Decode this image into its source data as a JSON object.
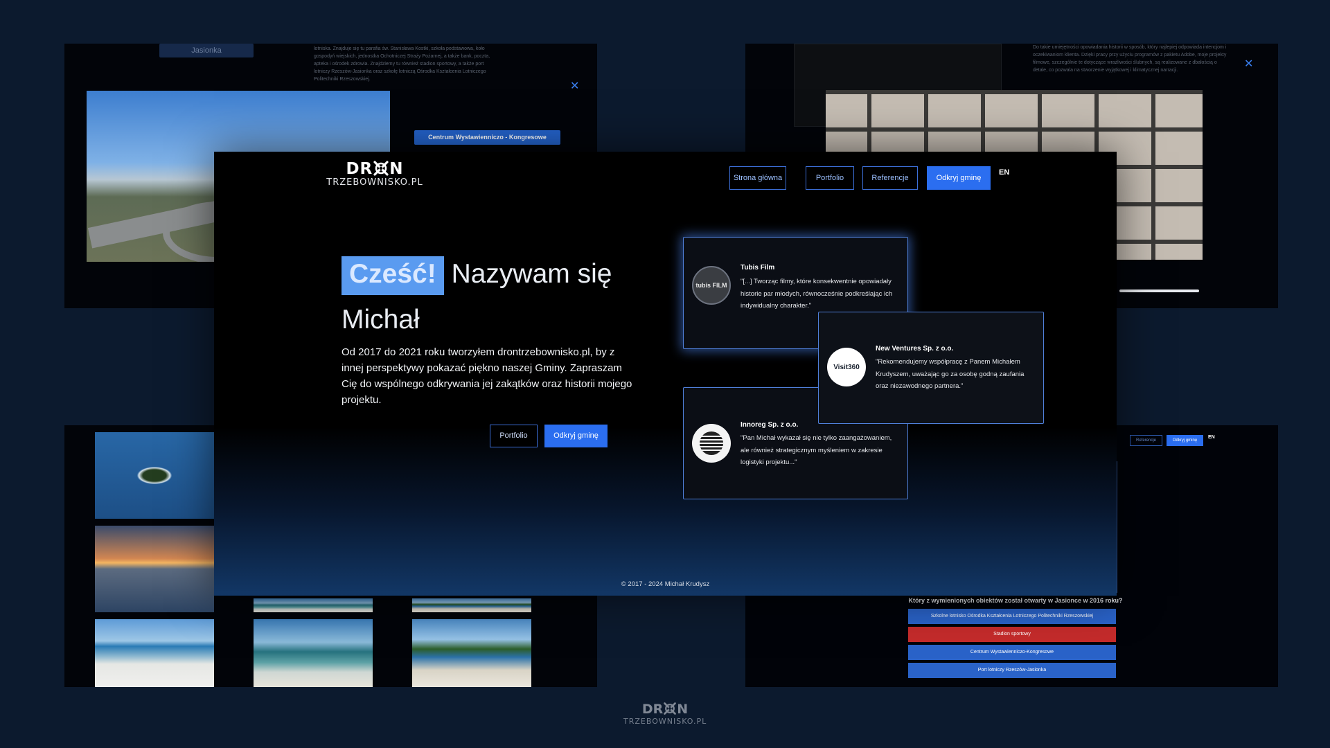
{
  "brand": {
    "logo_top": "DR N",
    "logo_bottom": "TRZEBOWNISKO.PL"
  },
  "nav": {
    "home": "Strona główna",
    "portfolio": "Portfolio",
    "references": "Referencje",
    "discover": "Odkryj gminę",
    "lang": "EN"
  },
  "hero": {
    "hi": "Cześć!",
    "rest": " Nazywam się Michał",
    "text": "Od 2017 do 2021 roku tworzyłem drontrzebownisko.pl, by z innej perspektywy pokazać piękno naszej Gminy. Zapraszam Cię do wspólnego odkrywania jej zakątków oraz historii mojego projektu.",
    "cta_portfolio": "Portfolio",
    "cta_discover": "Odkryj gminę"
  },
  "references": [
    {
      "name": "Tubis Film",
      "logo": "tubis FILM",
      "quote": "\"[...] Tworząc filmy, które konsekwentnie opowiadały historie par młodych, równocześnie podkreślając ich indywidualny charakter.\""
    },
    {
      "name": "New Ventures Sp. z o.o.",
      "logo": "Visit360",
      "quote": "\"Rekomendujemy współpracę z Panem Michałem Krudyszem, uważając go za osobę godną zaufania oraz niezawodnego partnera.\""
    },
    {
      "name": "Innoreg Sp. z o.o.",
      "logo": "",
      "quote": "\"Pan Michał wykazał się nie tylko zaangażowaniem, ale również strategicznym myśleniem w zakresie logistyki projektu...\""
    }
  ],
  "footer": {
    "copyright": "© 2017 - 2024 Michał Krudysz"
  },
  "bg_windows": {
    "tl_label": "Jasionka",
    "tl_button": "Centrum Wystawienniczo - Kongresowe",
    "tl_text": "lotniska. Znajduje się tu parafia św. Stanisława Kostki, szkoła podstawowa, koło gospodyń wiejskich, jednostka Ochotniczej Straży Pożarnej, a także bank, poczta, apteka i ośrodek zdrowia. Znajdziemy tu również stadion sportowy, a także port lotniczy Rzeszów-Jasionka oraz szkołę lotniczą Ośrodka Kształcenia Lotniczego Politechniki Rzeszowskiej.",
    "tr_text": "Do takie umiejętności opowiadania historii w sposób, który najlepiej odpowiada intencjom i oczekiwaniom klienta. Dzięki pracy przy użyciu programów z pakietu Adobe, moje projekty filmowe, szczególnie te dotyczące wrażliwości ślubnych, są realizowane z dbałością o detale, co pozwala na stworzenie wyjątkowej i klimatycznej narracji.",
    "br_nav_references": "Referencje",
    "br_nav_discover": "Odkryj gminę",
    "br_lang": "EN",
    "quiz_question": "Który z wymienionych obiektów został otwarty w Jasionce w 2016 roku?",
    "quiz_options": [
      "Szkolne lotnisko Ośrodka Kształcenia Lotniczego Politechniki Rzeszowskiej",
      "Stadion sportowy",
      "Centrum Wystawienniczo-Kongresowe",
      "Port lotniczy Rzeszów-Jasionka"
    ]
  },
  "colors": {
    "accent": "#2b6ef0",
    "hero_highlight": "#5a9bf0",
    "page_bg": "#0c1a2e",
    "wrong_answer": "#c42b2b"
  }
}
